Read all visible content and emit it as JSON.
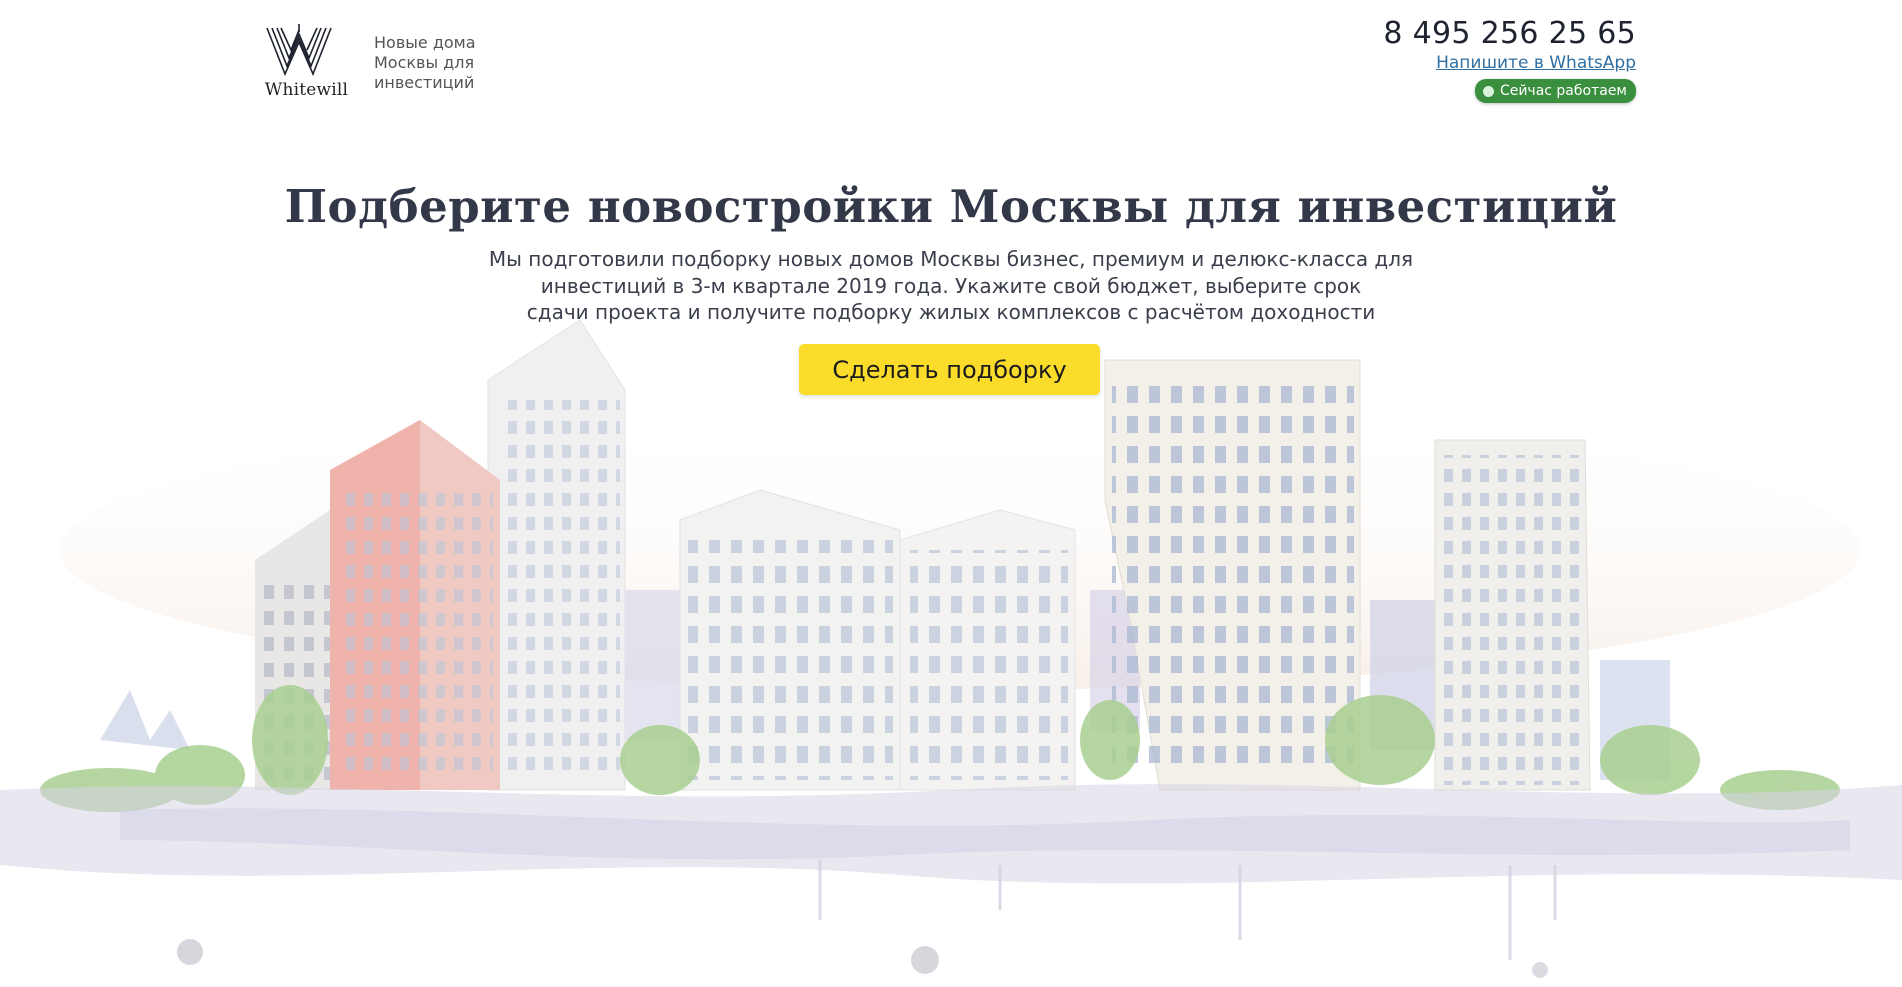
{
  "header": {
    "logo_text": "Whitewill",
    "tagline_lines": [
      "Новые дома",
      "Москвы для",
      "инвестиций"
    ],
    "phone": "8 495 256 25 65",
    "whatsapp_link": "Напишите в WhatsApp",
    "status_badge": "Сейчас работаем"
  },
  "hero": {
    "title": "Подберите новостройки Москвы для инвестиций",
    "description_lines": [
      "Мы подготовили подборку новых домов Москвы бизнес, премиум и делюкс-класса для",
      "инвестиций в 3-м квартале 2019 года. Укажите свой бюджет, выберите срок",
      "сдачи проекта и получите подборку жилых комплексов с расчётом доходности"
    ],
    "cta_label": "Сделать подборку"
  },
  "colors": {
    "cta_background": "#fbdc2b",
    "status_green": "#3a8f3f",
    "link_blue": "#2f6fa3",
    "title_dark": "#323848"
  },
  "icons": [
    "whitewill-logo-icon",
    "status-dot-icon"
  ]
}
